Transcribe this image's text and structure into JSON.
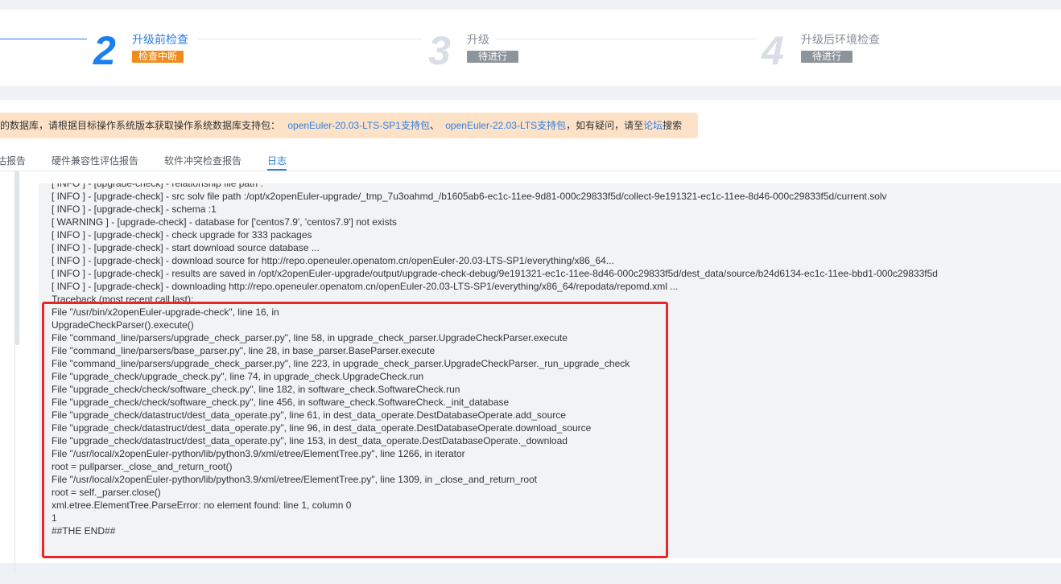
{
  "steps": [
    {
      "number": "2",
      "title": "升级前检查",
      "badge": "检查中断",
      "color": "#1a7ff0",
      "title_color": "#2b7fe0",
      "badge_color": "#f08c1c"
    },
    {
      "number": "3",
      "title": "升级",
      "badge": "待进行",
      "color": "#d9dee6",
      "title_color": "#888f99",
      "badge_color": "#8d949c"
    },
    {
      "number": "4",
      "title": "升级后环境检查",
      "badge": "待进行",
      "color": "#d9dee6",
      "title_color": "#888f99",
      "badge_color": "#8d949c"
    }
  ],
  "notice": {
    "text_before": "的数据库，请根据目标操作系统版本获取操作系统数据库支持包：",
    "link1": "openEuler-20.03-LTS-SP1支持包",
    "sep": "、",
    "link2": "openEuler-22.03-LTS支持包",
    "text_mid": "，如有疑问，请至",
    "link3": "论坛",
    "text_after": "搜索"
  },
  "tabs": [
    {
      "label": "估报告",
      "active": false
    },
    {
      "label": "硬件兼容性评估报告",
      "active": false
    },
    {
      "label": "软件冲突检查报告",
      "active": false
    },
    {
      "label": "日志",
      "active": true
    }
  ],
  "log_lines": [
    "[ INFO ] - [upgrade-check] - relationship file path :",
    "[ INFO ] - [upgrade-check] - src solv file path :/opt/x2openEuler-upgrade/_tmp_7u3oahmd_/b1605ab6-ec1c-11ee-9d81-000c29833f5d/collect-9e191321-ec1c-11ee-8d46-000c29833f5d/current.solv",
    "[ INFO ] - [upgrade-check] - schema :1",
    "[ WARNING ] - [upgrade-check] - database for ['centos7.9', 'centos7.9'] not exists",
    "[ INFO ] - [upgrade-check] - check upgrade for 333 packages",
    "[ INFO ] - [upgrade-check] - start download source database ...",
    "[ INFO ] - [upgrade-check] - download source for http://repo.openeuler.openatom.cn/openEuler-20.03-LTS-SP1/everything/x86_64...",
    "[ INFO ] - [upgrade-check] - results are saved in /opt/x2openEuler-upgrade/output/upgrade-check-debug/9e191321-ec1c-11ee-8d46-000c29833f5d/dest_data/source/b24d6134-ec1c-11ee-bbd1-000c29833f5d",
    "[ INFO ] - [upgrade-check] - downloading http://repo.openeuler.openatom.cn/openEuler-20.03-LTS-SP1/everything/x86_64/repodata/repomd.xml ...",
    "Traceback (most recent call last):",
    "File \"/usr/bin/x2openEuler-upgrade-check\", line 16, in",
    "UpgradeCheckParser().execute()",
    "File \"command_line/parsers/upgrade_check_parser.py\", line 58, in upgrade_check_parser.UpgradeCheckParser.execute",
    "File \"command_line/parsers/base_parser.py\", line 28, in base_parser.BaseParser.execute",
    "File \"command_line/parsers/upgrade_check_parser.py\", line 223, in upgrade_check_parser.UpgradeCheckParser._run_upgrade_check",
    "File \"upgrade_check/upgrade_check.py\", line 74, in upgrade_check.UpgradeCheck.run",
    "File \"upgrade_check/check/software_check.py\", line 182, in software_check.SoftwareCheck.run",
    "File \"upgrade_check/check/software_check.py\", line 456, in software_check.SoftwareCheck._init_database",
    "File \"upgrade_check/datastruct/dest_data_operate.py\", line 61, in dest_data_operate.DestDatabaseOperate.add_source",
    "File \"upgrade_check/datastruct/dest_data_operate.py\", line 96, in dest_data_operate.DestDatabaseOperate.download_source",
    "File \"upgrade_check/datastruct/dest_data_operate.py\", line 153, in dest_data_operate.DestDatabaseOperate._download",
    "File \"/usr/local/x2openEuler-python/lib/python3.9/xml/etree/ElementTree.py\", line 1266, in iterator",
    "root = pullparser._close_and_return_root()",
    "File \"/usr/local/x2openEuler-python/lib/python3.9/xml/etree/ElementTree.py\", line 1309, in _close_and_return_root",
    "root = self._parser.close()",
    "xml.etree.ElementTree.ParseError: no element found: line 1, column 0",
    "1",
    "##THE END##"
  ]
}
